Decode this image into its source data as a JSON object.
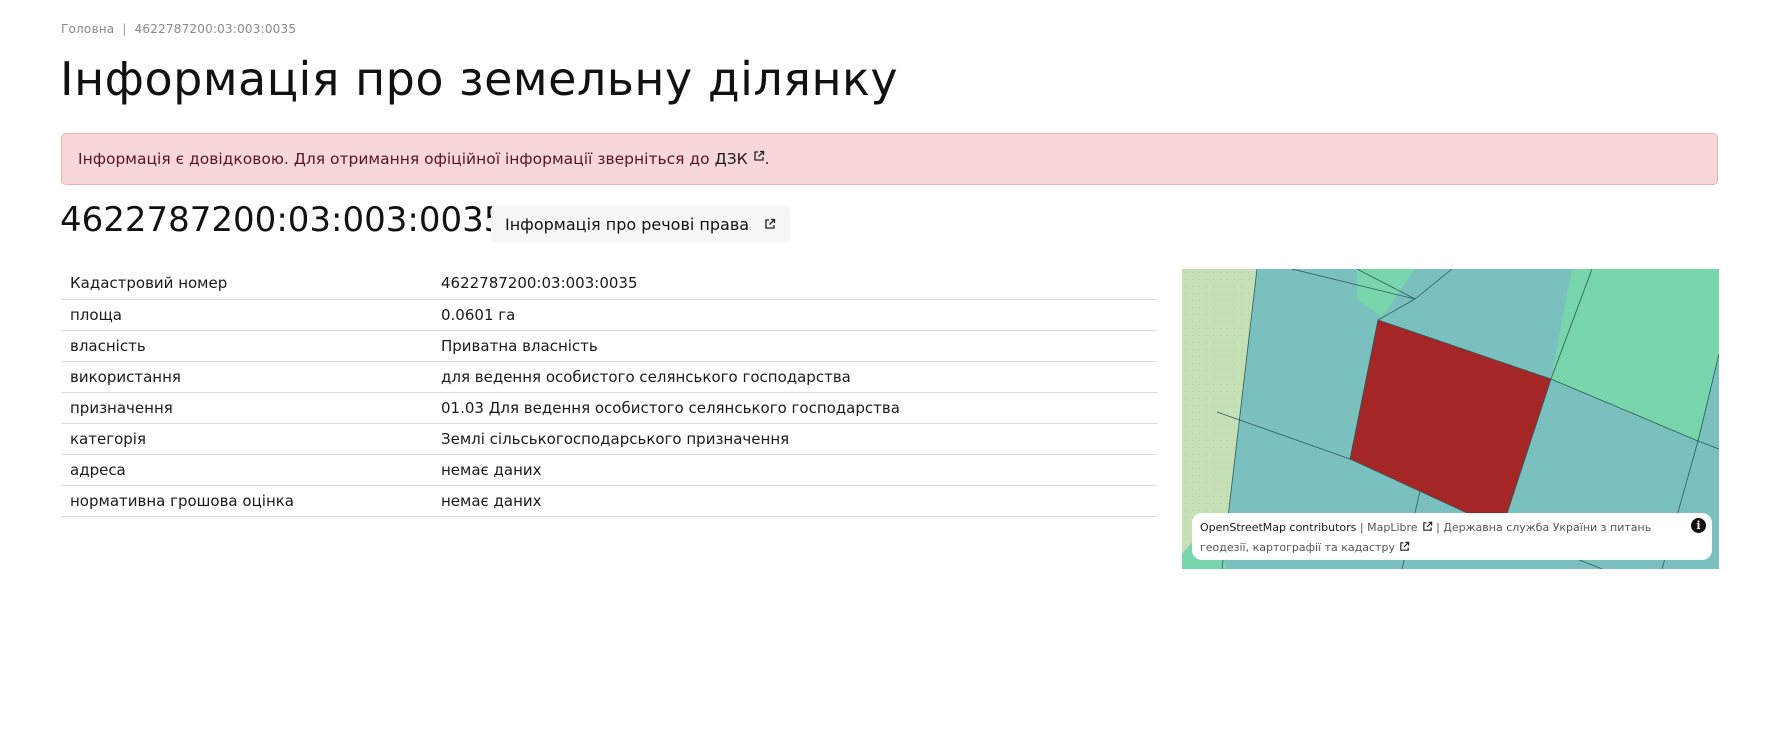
{
  "breadcrumb": {
    "home": "Головна",
    "separator": "|",
    "current": "4622787200:03:003:0035"
  },
  "page_title": "Інформація про земельну ділянку",
  "alert": {
    "text": "Інформація є довідковою. Для отримання офіційної інформації зверніться до",
    "link": "ДЗК",
    "suffix": "."
  },
  "cadastral_heading": "4622787200:03:003:0035",
  "rights_button": "Інформація про речові права",
  "table": [
    {
      "key": "Кадастровий номер",
      "value": "4622787200:03:003:0035"
    },
    {
      "key": "площа",
      "value": "0.0601 га"
    },
    {
      "key": "власність",
      "value": "Приватна власність"
    },
    {
      "key": "використання",
      "value": "для ведення особистого селянського господарства"
    },
    {
      "key": "призначення",
      "value": "01.03 Для ведення особистого селянського господарства"
    },
    {
      "key": "категорія",
      "value": "Землі сільськогосподарського призначення"
    },
    {
      "key": "адреса",
      "value": "немає даних"
    },
    {
      "key": "нормативна грошова оцінка",
      "value": "немає даних"
    }
  ],
  "map": {
    "colors": {
      "parcel_teal": "#7ac0bf",
      "parcel_green": "#79d5ab",
      "selected_parcel": "#a52626",
      "meadow": "#c5dfb6"
    },
    "attribution": {
      "osm": "OpenStreetMap contributors",
      "separator1": "|",
      "maplibre": "MapLibre",
      "separator2": "|",
      "agency": "Державна служба України з питань геодезії, картографії та кадастру"
    },
    "info_icon": "i"
  }
}
